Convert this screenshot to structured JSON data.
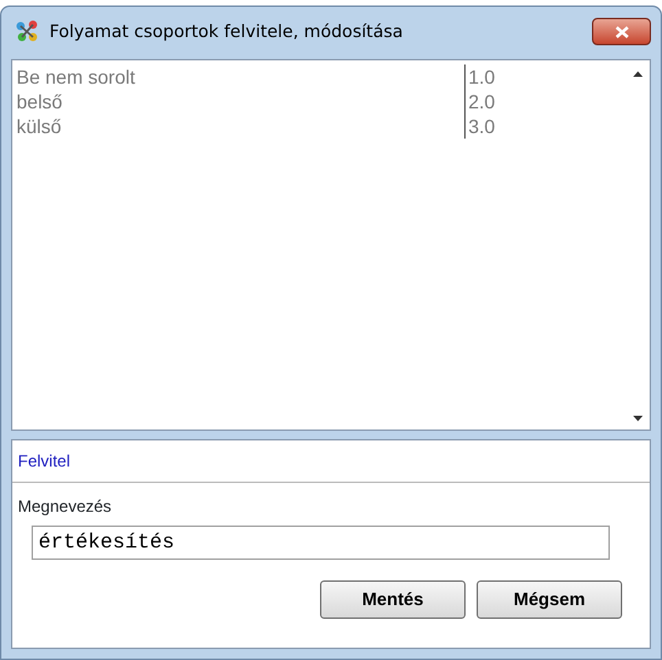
{
  "window": {
    "title": "Folyamat csoportok felvitele, módosítása"
  },
  "list": {
    "rows": [
      {
        "name": "Be nem sorolt",
        "value": "1.0"
      },
      {
        "name": "belső",
        "value": "2.0"
      },
      {
        "name": "külső",
        "value": "3.0"
      }
    ]
  },
  "panel": {
    "tab": "Felvitel",
    "label": "Megnevezés",
    "value": "értékesítés"
  },
  "buttons": [
    "Mentés",
    "Mégsem"
  ]
}
